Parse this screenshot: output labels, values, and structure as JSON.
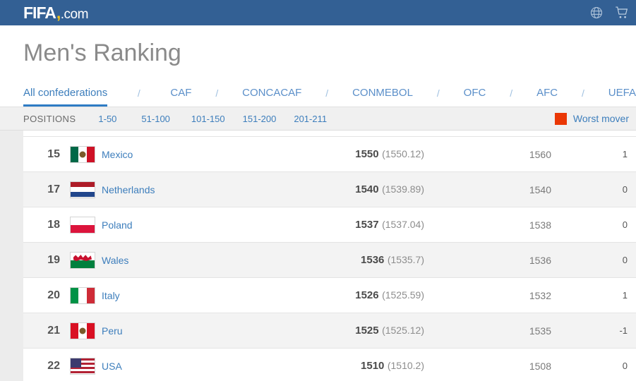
{
  "header": {
    "logo_fifa": "FIFA",
    "logo_tick": ",",
    "logo_com": ".com",
    "globe_icon": "globe-icon",
    "cart_icon": "shopping-cart-icon"
  },
  "page": {
    "title": "Men's Ranking"
  },
  "confederations": {
    "separator": "/",
    "tabs": [
      {
        "label": "All confederations",
        "active": true
      },
      {
        "label": "CAF",
        "active": false
      },
      {
        "label": "CONCACAF",
        "active": false
      },
      {
        "label": "CONMEBOL",
        "active": false
      },
      {
        "label": "OFC",
        "active": false
      },
      {
        "label": "AFC",
        "active": false
      },
      {
        "label": "UEFA",
        "active": false
      }
    ]
  },
  "positions": {
    "label": "POSITIONS",
    "ranges": [
      "1-50",
      "51-100",
      "101-150",
      "151-200",
      "201-211"
    ],
    "worst_mover_label": "Worst mover",
    "worst_mover_color": "#ea3705"
  },
  "rows": [
    {
      "rank": "15",
      "team": "Mexico",
      "points": "1550",
      "points_exact": "(1550.12)",
      "previous": "1560",
      "change": "1"
    },
    {
      "rank": "17",
      "team": "Netherlands",
      "points": "1540",
      "points_exact": "(1539.89)",
      "previous": "1540",
      "change": "0"
    },
    {
      "rank": "18",
      "team": "Poland",
      "points": "1537",
      "points_exact": "(1537.04)",
      "previous": "1538",
      "change": "0"
    },
    {
      "rank": "19",
      "team": "Wales",
      "points": "1536",
      "points_exact": "(1535.7)",
      "previous": "1536",
      "change": "0"
    },
    {
      "rank": "20",
      "team": "Italy",
      "points": "1526",
      "points_exact": "(1525.59)",
      "previous": "1532",
      "change": "1"
    },
    {
      "rank": "21",
      "team": "Peru",
      "points": "1525",
      "points_exact": "(1525.12)",
      "previous": "1535",
      "change": "-1"
    },
    {
      "rank": "22",
      "team": "USA",
      "points": "1510",
      "points_exact": "(1510.2)",
      "previous": "1508",
      "change": "0"
    }
  ],
  "theme": {
    "header_blue": "#336094",
    "link_blue": "#3d7ebc",
    "active_underline": "#2e7cc4"
  }
}
